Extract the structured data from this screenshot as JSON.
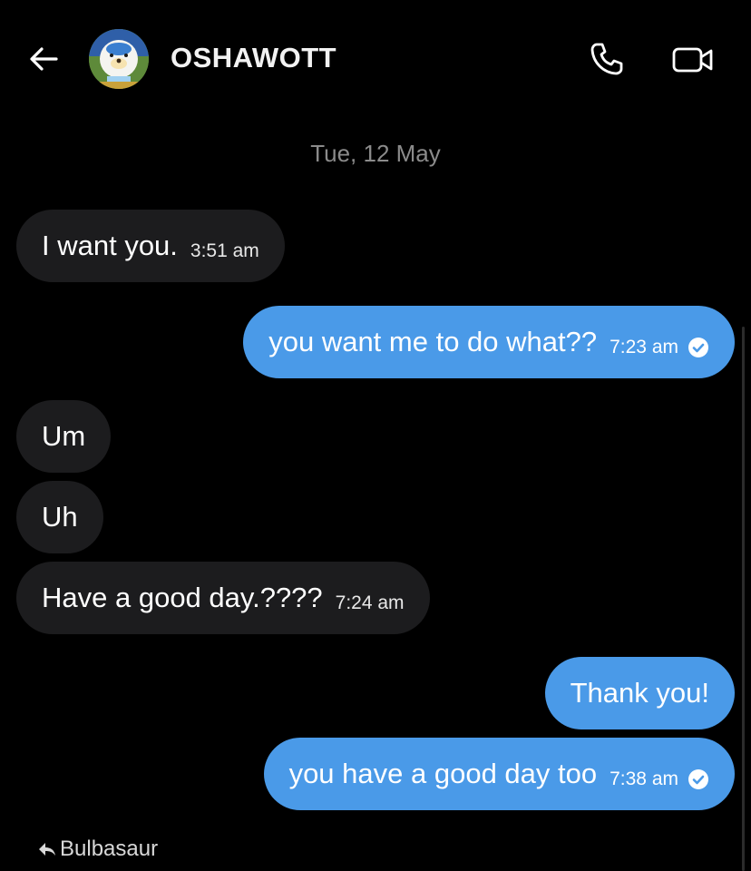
{
  "header": {
    "back_icon": "arrow-left-icon",
    "contact_name": "OSHAWOTT",
    "call_icon": "phone-icon",
    "video_icon": "video-camera-icon"
  },
  "date_separator": "Tue, 12 May",
  "messages": [
    {
      "direction": "incoming",
      "text": "I want you.",
      "time": "3:51 am"
    },
    {
      "direction": "outgoing",
      "text": "you want me to do what??",
      "time": "7:23 am",
      "read": true
    },
    {
      "direction": "incoming",
      "text": "Um",
      "time": ""
    },
    {
      "direction": "incoming",
      "text": "Uh",
      "time": ""
    },
    {
      "direction": "incoming",
      "text": "Have a good day.????",
      "time": "7:24 am"
    },
    {
      "direction": "outgoing",
      "text": "Thank you!",
      "time": ""
    },
    {
      "direction": "outgoing",
      "text": "you have a good day too",
      "time": "7:38 am",
      "read": true
    }
  ],
  "reply_hint": {
    "icon": "reply-arrow-icon",
    "label": "Bulbasaur"
  },
  "colors": {
    "background": "#000000",
    "incoming_bubble": "#1c1c1e",
    "outgoing_bubble": "#4a9ae8",
    "muted_text": "#8b8b8b"
  }
}
